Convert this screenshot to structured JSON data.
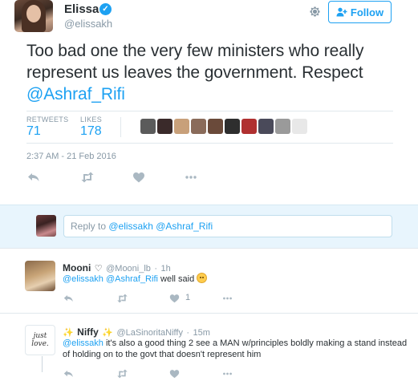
{
  "tweet": {
    "author_name": "Elissa",
    "author_handle": "@elissakh",
    "follow_label": "Follow",
    "text_before": "Too bad one the very few ministers who really represent us leaves the government. Respect ",
    "mention": "@Ashraf_Rifi",
    "retweets_label": "RETWEETS",
    "retweets_count": "71",
    "likes_label": "LIKES",
    "likes_count": "178",
    "timestamp": "2:37 AM - 21 Feb 2016"
  },
  "liker_avatar_colors": [
    "#5b5b5b",
    "#3a2a2a",
    "#c8a07a",
    "#8a6b5a",
    "#6a4a3a",
    "#2e2e2e",
    "#b03030",
    "#4a4a5a",
    "#9a9a9a",
    "#e8e8e8"
  ],
  "reply_box": {
    "prefix": "Reply to ",
    "mention1": "@elissakh",
    "mention2": "@Ashraf_Rifi"
  },
  "replies": [
    {
      "name": "Mooni",
      "heart": "♡",
      "handle": "@Mooni_lb",
      "time": "1h",
      "mention1": "@elissakh",
      "mention2": "@Ashraf_Rifi",
      "text": " well said ",
      "like_count": "1"
    },
    {
      "name": "Niffy",
      "sparkle": "✨",
      "handle": "@LaSinoritaNiffy",
      "time": "15m",
      "mention": "@elissakh",
      "text": " it's also a good thing 2 see a MAN w/principles boldly making a stand instead of holding on to the govt that doesn't represent him",
      "avatar_text": "just love."
    }
  ],
  "colors": {
    "accent": "#1da1f2",
    "muted": "#8899a6",
    "reply_bg": "#e8f5fd"
  },
  "icons": [
    "verified-badge-icon",
    "gear-icon",
    "follow-person-icon",
    "reply-icon",
    "retweet-icon",
    "like-icon",
    "more-icon"
  ]
}
